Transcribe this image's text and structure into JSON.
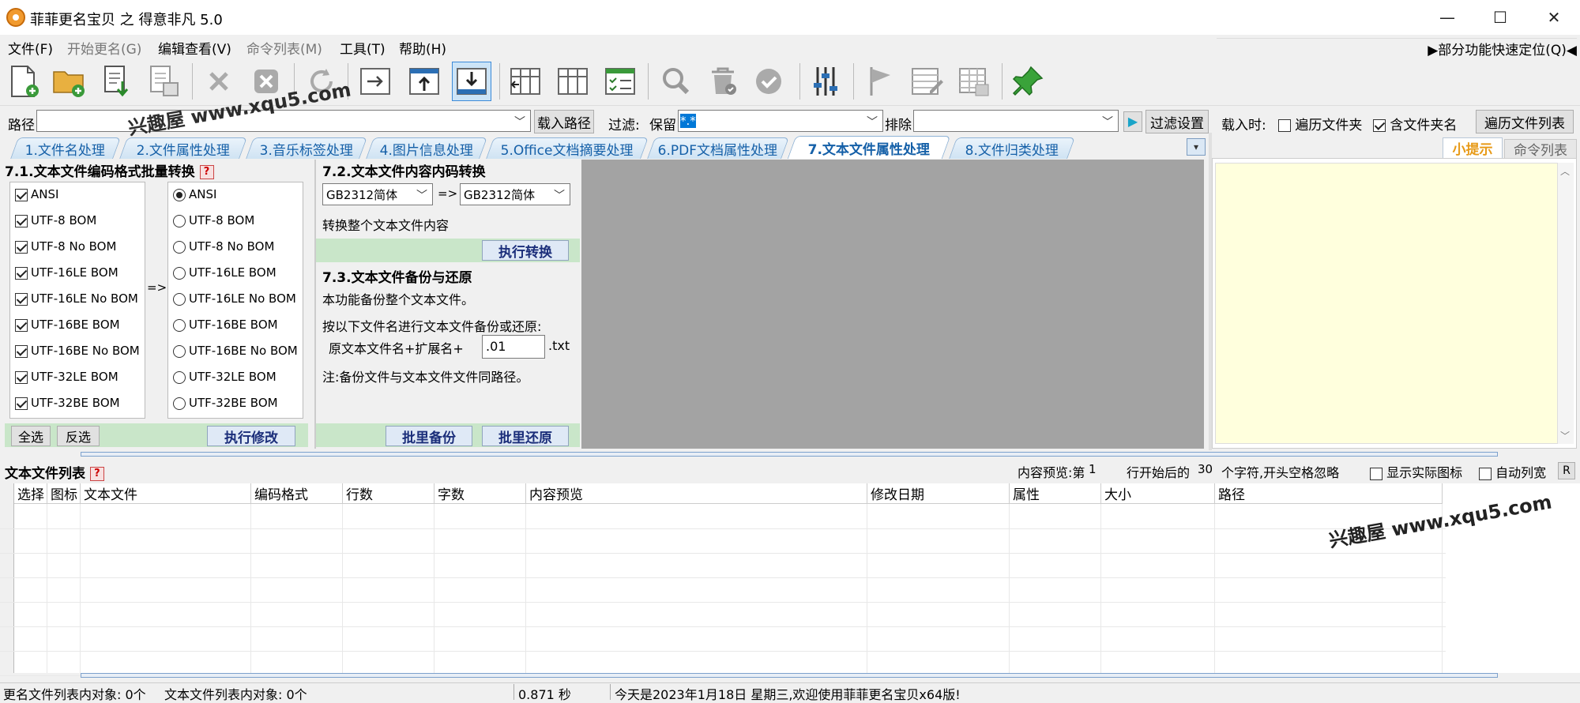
{
  "window": {
    "title": "菲菲更名宝贝 之 得意非凡 5.0",
    "minimize": "—",
    "maximize": "☐",
    "close": "✕"
  },
  "menu": {
    "items": [
      "文件(F)",
      "开始更名(G)",
      "编辑查看(V)",
      "命令列表(M)",
      "工具(T)",
      "帮助(H)"
    ],
    "quick_locate": "▶部分功能快速定位(Q)◀"
  },
  "toolbar": {
    "icons": [
      "new-file-icon",
      "open-folder-icon",
      "import-icon",
      "export-icon",
      "delete-icon",
      "remove-icon",
      "refresh-icon",
      "move-right-icon",
      "move-top-icon",
      "move-bottom-icon",
      "columns-left-icon",
      "columns-icon",
      "checklist-icon",
      "search-icon",
      "trash-icon",
      "check-icon",
      "sliders-icon",
      "flag-icon",
      "edit-table-icon",
      "table-icon",
      "pin-icon"
    ]
  },
  "pathbar": {
    "path_label": "路径",
    "path_value": "",
    "load_path": "载入路径",
    "filter_label": "过滤:",
    "keep_label": "保留",
    "keep_value": "*.*",
    "exclude_label": "排除",
    "exclude_value": "",
    "play_icon": "▶",
    "filter_settings": "过滤设置",
    "load_when": "载入时:",
    "traverse_folders": "遍历文件夹",
    "include_folder_name": "含文件夹名",
    "traverse_list": "遍历文件列表"
  },
  "tabs": [
    "1.文件名处理",
    "2.文件属性处理",
    "3.音乐标签处理",
    "4.图片信息处理",
    "5.Office文档摘要处理",
    "6.PDF文档属性处理",
    "7.文本文件属性处理",
    "8.文件归类处理"
  ],
  "tabs_more": "▾",
  "watermark": "兴趣屋 www.xqu5.com",
  "section71": {
    "title": "7.1.文本文件编码格式批量转换",
    "help": "?",
    "arrow": "=>",
    "left_items": [
      "ANSI",
      "UTF-8 BOM",
      "UTF-8 No BOM",
      "UTF-16LE BOM",
      "UTF-16LE No BOM",
      "UTF-16BE BOM",
      "UTF-16BE No BOM",
      "UTF-32LE BOM",
      "UTF-32BE BOM"
    ],
    "right_items": [
      "ANSI",
      "UTF-8 BOM",
      "UTF-8 No BOM",
      "UTF-16LE BOM",
      "UTF-16LE No BOM",
      "UTF-16BE BOM",
      "UTF-16BE No BOM",
      "UTF-32LE BOM",
      "UTF-32BE BOM"
    ],
    "select_all": "全选",
    "invert": "反选",
    "execute": "执行修改"
  },
  "section72": {
    "title": "7.2.文本文件内容内码转换",
    "from": "GB2312简体",
    "arrow": "=>",
    "to": "GB2312简体",
    "desc": "转换整个文本文件内容",
    "execute": "执行转换"
  },
  "section73": {
    "title": "7.3.文本文件备份与还原",
    "line1": "本功能备份整个文本文件。",
    "line2": "按以下文件名进行文本文件备份或还原:",
    "name_label": "原文本文件名+扩展名+",
    "ext_value": ".01",
    "ext_suffix": ".txt",
    "note": "注:备份文件与文本文件文件同路径。",
    "backup": "批里备份",
    "restore": "批里还原"
  },
  "right_panel": {
    "tab_tips": "小提示",
    "tab_commands": "命令列表"
  },
  "list": {
    "title": "文本文件列表",
    "help": "?",
    "preview_label": "内容预览:第",
    "preview_line": "1",
    "after_line": "行开始后的",
    "chars": "30",
    "chars_label": "个字符,开头空格忽略",
    "show_icons": "显示实际图标",
    "auto_width": "自动列宽",
    "r_button": "R",
    "columns": [
      "选择",
      "图标",
      "文本文件",
      "编码格式",
      "行数",
      "字数",
      "内容预览",
      "修改日期",
      "属性",
      "大小",
      "路径"
    ]
  },
  "status": {
    "rename_count": "更名文件列表内对象: 0个",
    "text_count": "文本文件列表内对象: 0个",
    "time": "0.871 秒",
    "message": "今天是2023年1月18日 星期三,欢迎使用菲菲更名宝贝x64版!"
  }
}
